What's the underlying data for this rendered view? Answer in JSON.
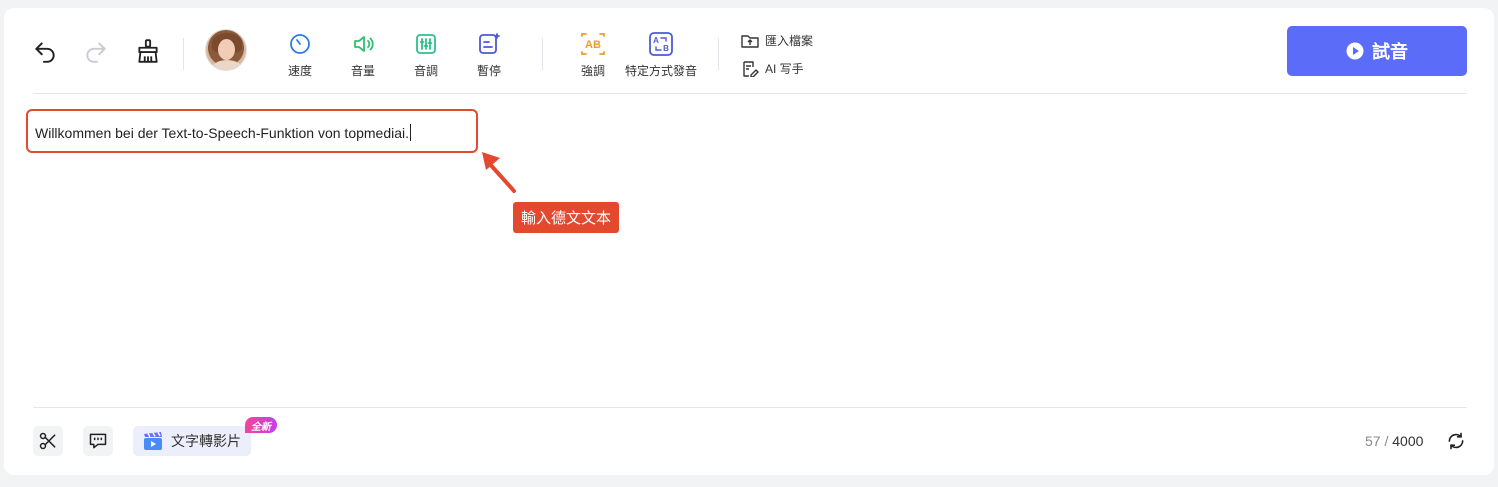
{
  "toolbar": {
    "tools": {
      "speed": "速度",
      "volume": "音量",
      "pitch": "音調",
      "pause": "暫停",
      "emphasis": "強調",
      "pronunciation": "特定方式發音"
    },
    "import_file": "匯入檔案",
    "ai_writer": "AI 写手",
    "play_label": "試音"
  },
  "editor": {
    "text": "Willkommen bei der Text-to-Speech-Funktion von topmediai."
  },
  "annotation": {
    "callout_text": "輸入德文文本"
  },
  "bottom": {
    "text_to_video": "文字轉影片",
    "new_badge": "全新",
    "char_count": "57",
    "char_separator": " / ",
    "char_limit": "4000"
  },
  "colors": {
    "accent": "#5b6cf9",
    "annotation": "#e2492f",
    "speed_icon": "#2f7de1",
    "volume_icon": "#2fbf71",
    "pitch_icon": "#2fbf8a",
    "pause_icon": "#4b5bd6",
    "emphasis_icon": "#f29a2e",
    "pronunciation_icon": "#4b5bd6"
  }
}
